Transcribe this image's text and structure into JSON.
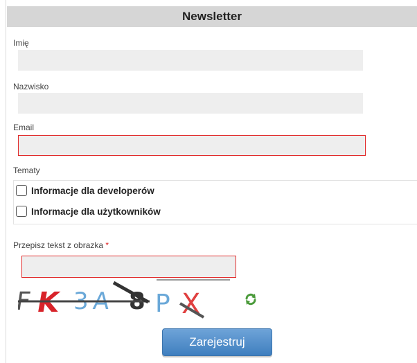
{
  "form": {
    "title": "Newsletter",
    "first_name": {
      "label": "Imię",
      "value": ""
    },
    "last_name": {
      "label": "Nazwisko",
      "value": ""
    },
    "email": {
      "label": "Email",
      "value": ""
    },
    "topics": {
      "label": "Tematy",
      "options": [
        {
          "label": "Informacje dla developerów",
          "checked": false
        },
        {
          "label": "Informacje dla użytkowników",
          "checked": false
        }
      ]
    },
    "captcha": {
      "label": "Przepisz tekst z obrazka",
      "required_marker": "*",
      "value": "",
      "image_text": "FK3A8PX"
    },
    "submit_label": "Zarejestruj"
  },
  "colors": {
    "header_bg": "#d6d6d6",
    "field_bg": "#eeeeee",
    "error_border": "#e12b2b",
    "button_blue": "#3f7fbf",
    "refresh_green": "#4a9a3a"
  },
  "icons": {
    "refresh": "refresh-icon"
  }
}
